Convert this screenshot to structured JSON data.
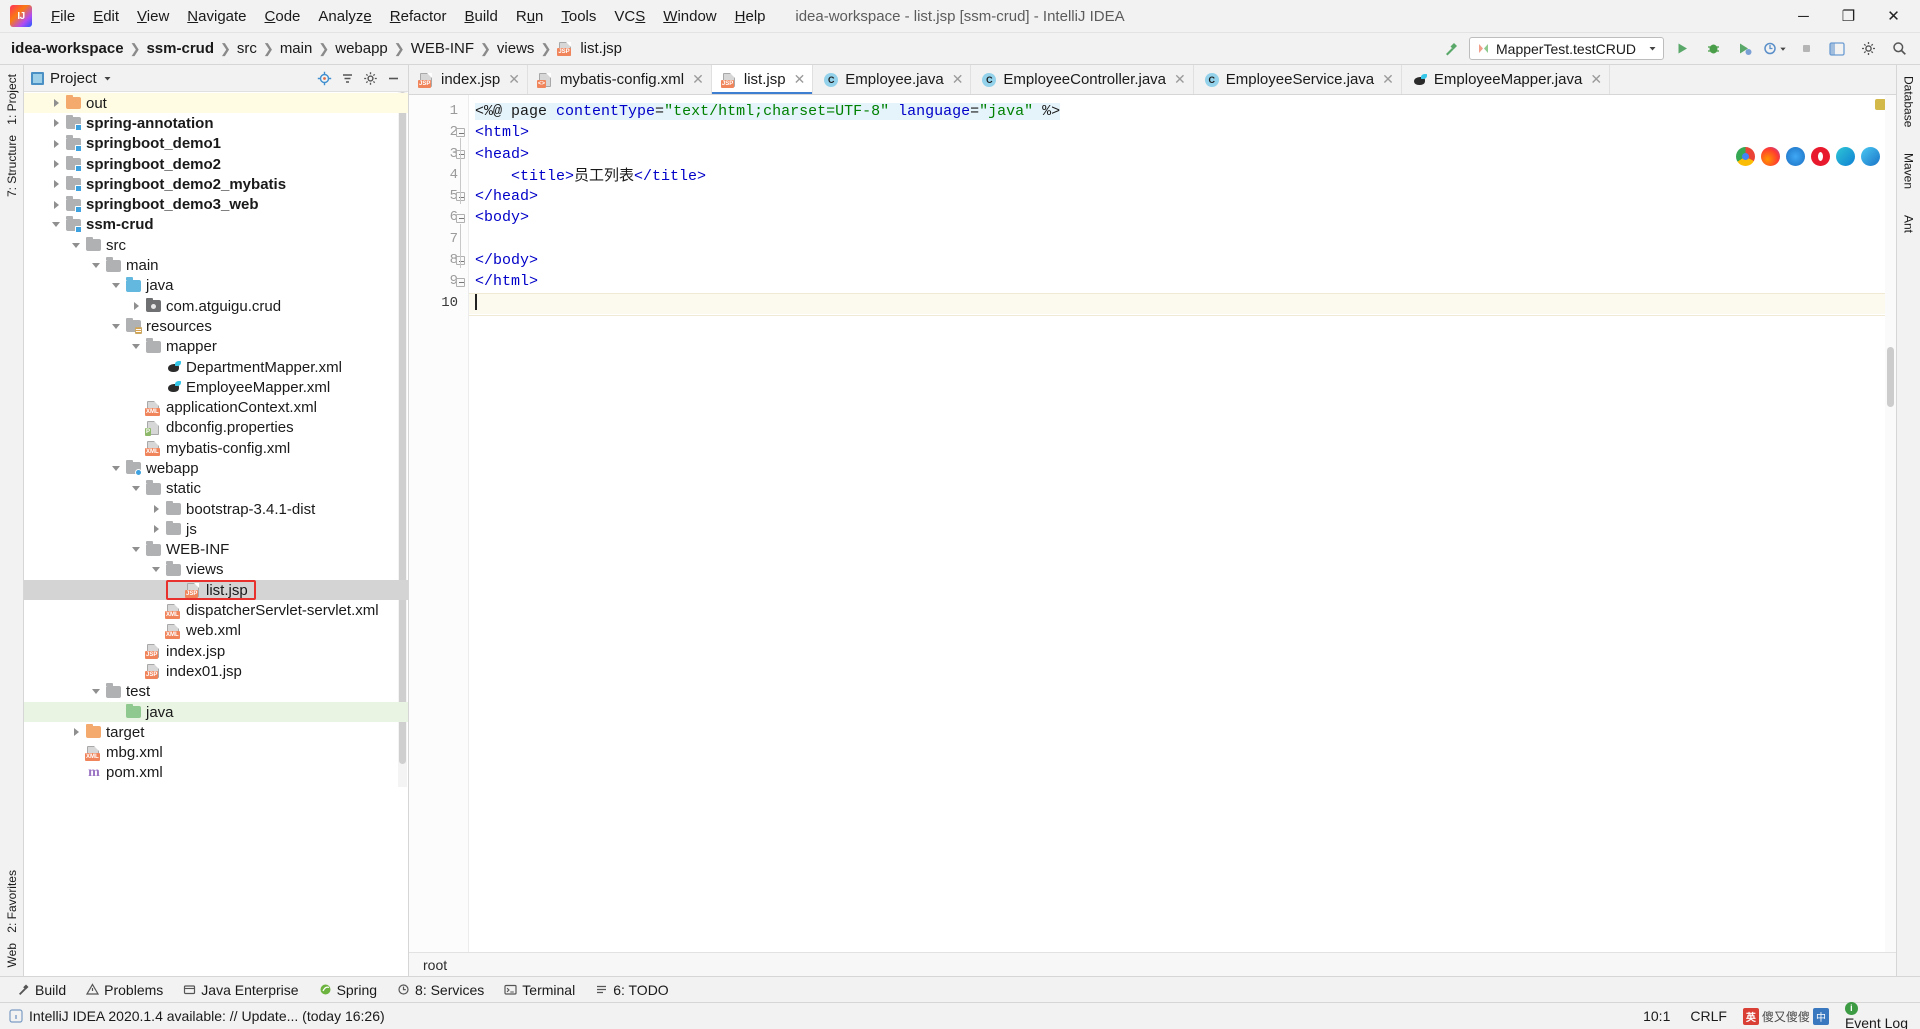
{
  "window": {
    "title": "idea-workspace - list.jsp [ssm-crud] - IntelliJ IDEA",
    "minimize": "─",
    "maximize": "❐",
    "close": "✕"
  },
  "menu": [
    {
      "label": "File"
    },
    {
      "label": "Edit"
    },
    {
      "label": "View"
    },
    {
      "label": "Navigate"
    },
    {
      "label": "Code"
    },
    {
      "label": "Analyze"
    },
    {
      "label": "Refactor"
    },
    {
      "label": "Build"
    },
    {
      "label": "Run"
    },
    {
      "label": "Tools"
    },
    {
      "label": "VCS"
    },
    {
      "label": "Window"
    },
    {
      "label": "Help"
    }
  ],
  "breadcrumb": [
    {
      "label": "idea-workspace",
      "bold": true
    },
    {
      "label": "ssm-crud",
      "bold": true
    },
    {
      "label": "src",
      "bold": false
    },
    {
      "label": "main",
      "bold": false
    },
    {
      "label": "webapp",
      "bold": false
    },
    {
      "label": "WEB-INF",
      "bold": false
    },
    {
      "label": "views",
      "bold": false
    },
    {
      "label": "list.jsp",
      "bold": false,
      "icon": "jsp-file-icon"
    }
  ],
  "toolbar": {
    "build_label": "build-hammer-icon",
    "run_config": "MapperTest.testCRUD",
    "run_icon": "run-icon",
    "debug_icon": "debug-icon",
    "run_coverage_icon": "run-with-coverage-icon",
    "profile_icon": "profiler-icon",
    "stop_icon": "stop-icon",
    "layout_icon": "layout-icon",
    "settings_icon": "settings-icon",
    "search_icon": "search-everywhere-icon"
  },
  "project_panel": {
    "title": "Project",
    "actions": [
      "locate-icon",
      "collapse-all-icon",
      "settings-icon",
      "hide-icon"
    ],
    "tree": [
      {
        "label": "out",
        "depth": 1,
        "arrow": "closed",
        "icon": "folder-orange",
        "bold": false,
        "hl": "yellow"
      },
      {
        "label": "spring-annotation",
        "depth": 1,
        "arrow": "closed",
        "icon": "module",
        "bold": true,
        "hl": ""
      },
      {
        "label": "springboot_demo1",
        "depth": 1,
        "arrow": "closed",
        "icon": "module",
        "bold": true,
        "hl": ""
      },
      {
        "label": "springboot_demo2",
        "depth": 1,
        "arrow": "closed",
        "icon": "module",
        "bold": true,
        "hl": ""
      },
      {
        "label": "springboot_demo2_mybatis",
        "depth": 1,
        "arrow": "closed",
        "icon": "module",
        "bold": true,
        "hl": ""
      },
      {
        "label": "springboot_demo3_web",
        "depth": 1,
        "arrow": "closed",
        "icon": "module",
        "bold": true,
        "hl": ""
      },
      {
        "label": "ssm-crud",
        "depth": 1,
        "arrow": "open",
        "icon": "module",
        "bold": true,
        "hl": ""
      },
      {
        "label": "src",
        "depth": 2,
        "arrow": "open",
        "icon": "folder-gray",
        "bold": false,
        "hl": ""
      },
      {
        "label": "main",
        "depth": 3,
        "arrow": "open",
        "icon": "folder-gray",
        "bold": false,
        "hl": ""
      },
      {
        "label": "java",
        "depth": 4,
        "arrow": "open",
        "icon": "folder-blue",
        "bold": false,
        "hl": ""
      },
      {
        "label": "com.atguigu.crud",
        "depth": 5,
        "arrow": "closed",
        "icon": "package",
        "bold": false,
        "hl": ""
      },
      {
        "label": "resources",
        "depth": 4,
        "arrow": "open",
        "icon": "folder-resources",
        "bold": false,
        "hl": ""
      },
      {
        "label": "mapper",
        "depth": 5,
        "arrow": "open",
        "icon": "folder-gray",
        "bold": false,
        "hl": ""
      },
      {
        "label": "DepartmentMapper.xml",
        "depth": 6,
        "arrow": "none",
        "icon": "mybatis",
        "bold": false,
        "hl": ""
      },
      {
        "label": "EmployeeMapper.xml",
        "depth": 6,
        "arrow": "none",
        "icon": "mybatis",
        "bold": false,
        "hl": ""
      },
      {
        "label": "applicationContext.xml",
        "depth": 5,
        "arrow": "none",
        "icon": "xml",
        "bold": false,
        "hl": ""
      },
      {
        "label": "dbconfig.properties",
        "depth": 5,
        "arrow": "none",
        "icon": "properties",
        "bold": false,
        "hl": ""
      },
      {
        "label": "mybatis-config.xml",
        "depth": 5,
        "arrow": "none",
        "icon": "xml",
        "bold": false,
        "hl": ""
      },
      {
        "label": "webapp",
        "depth": 4,
        "arrow": "open",
        "icon": "folder-webapp",
        "bold": false,
        "hl": ""
      },
      {
        "label": "static",
        "depth": 5,
        "arrow": "open",
        "icon": "folder-gray",
        "bold": false,
        "hl": ""
      },
      {
        "label": "bootstrap-3.4.1-dist",
        "depth": 6,
        "arrow": "closed",
        "icon": "folder-gray",
        "bold": false,
        "hl": ""
      },
      {
        "label": "js",
        "depth": 6,
        "arrow": "closed",
        "icon": "folder-gray",
        "bold": false,
        "hl": ""
      },
      {
        "label": "WEB-INF",
        "depth": 5,
        "arrow": "open",
        "icon": "folder-gray",
        "bold": false,
        "hl": ""
      },
      {
        "label": "views",
        "depth": 6,
        "arrow": "open",
        "icon": "folder-gray",
        "bold": false,
        "hl": ""
      },
      {
        "label": "list.jsp",
        "depth": 7,
        "arrow": "none",
        "icon": "jsp",
        "bold": false,
        "hl": "selected",
        "boxed": true
      },
      {
        "label": "dispatcherServlet-servlet.xml",
        "depth": 6,
        "arrow": "none",
        "icon": "xml",
        "bold": false,
        "hl": ""
      },
      {
        "label": "web.xml",
        "depth": 6,
        "arrow": "none",
        "icon": "xml",
        "bold": false,
        "hl": ""
      },
      {
        "label": "index.jsp",
        "depth": 5,
        "arrow": "none",
        "icon": "jsp",
        "bold": false,
        "hl": ""
      },
      {
        "label": "index01.jsp",
        "depth": 5,
        "arrow": "none",
        "icon": "jsp",
        "bold": false,
        "hl": ""
      },
      {
        "label": "test",
        "depth": 3,
        "arrow": "open",
        "icon": "folder-gray",
        "bold": false,
        "hl": ""
      },
      {
        "label": "java",
        "depth": 4,
        "arrow": "none",
        "icon": "folder-test",
        "bold": false,
        "hl": "green"
      },
      {
        "label": "target",
        "depth": 2,
        "arrow": "closed",
        "icon": "folder-orange",
        "bold": false,
        "hl": ""
      },
      {
        "label": "mbg.xml",
        "depth": 2,
        "arrow": "none",
        "icon": "xml",
        "bold": false,
        "hl": ""
      },
      {
        "label": "pom.xml",
        "depth": 2,
        "arrow": "none",
        "icon": "maven",
        "bold": false,
        "hl": ""
      }
    ]
  },
  "editor": {
    "tabs": [
      {
        "label": "index.jsp",
        "icon": "jsp",
        "active": false
      },
      {
        "label": "mybatis-config.xml",
        "icon": "xml-code",
        "active": false
      },
      {
        "label": "list.jsp",
        "icon": "jsp",
        "active": true
      },
      {
        "label": "Employee.java",
        "icon": "class",
        "active": false
      },
      {
        "label": "EmployeeController.java",
        "icon": "class",
        "active": false
      },
      {
        "label": "EmployeeService.java",
        "icon": "class",
        "active": false
      },
      {
        "label": "EmployeeMapper.java",
        "icon": "mybatis",
        "active": false
      }
    ],
    "line_numbers": [
      "1",
      "2",
      "3",
      "4",
      "5",
      "6",
      "7",
      "8",
      "9",
      "10"
    ],
    "code_lines": [
      {
        "n": 1,
        "tokens": [
          {
            "t": "<%@ page ",
            "c": "plain",
            "jsp": true
          },
          {
            "t": "contentType",
            "c": "attr",
            "jsp": true
          },
          {
            "t": "=",
            "c": "plain",
            "jsp": true
          },
          {
            "t": "\"text/html;charset=UTF-8\"",
            "c": "str",
            "jsp": true
          },
          {
            "t": " ",
            "c": "plain",
            "jsp": true
          },
          {
            "t": "language",
            "c": "attr",
            "jsp": true
          },
          {
            "t": "=",
            "c": "plain",
            "jsp": true
          },
          {
            "t": "\"java\"",
            "c": "str",
            "jsp": true
          },
          {
            "t": " %>",
            "c": "plain",
            "jsp": true
          }
        ]
      },
      {
        "n": 2,
        "tokens": [
          {
            "t": "<html>",
            "c": "tag"
          }
        ]
      },
      {
        "n": 3,
        "tokens": [
          {
            "t": "<head>",
            "c": "tag"
          }
        ]
      },
      {
        "n": 4,
        "tokens": [
          {
            "t": "    <title>",
            "c": "tag"
          },
          {
            "t": "员工列表",
            "c": "cjk"
          },
          {
            "t": "</title>",
            "c": "tag"
          }
        ]
      },
      {
        "n": 5,
        "tokens": [
          {
            "t": "</head>",
            "c": "tag"
          }
        ]
      },
      {
        "n": 6,
        "tokens": [
          {
            "t": "<body>",
            "c": "tag"
          }
        ]
      },
      {
        "n": 7,
        "tokens": []
      },
      {
        "n": 8,
        "tokens": [
          {
            "t": "</body>",
            "c": "tag"
          }
        ]
      },
      {
        "n": 9,
        "tokens": [
          {
            "t": "</html>",
            "c": "tag"
          }
        ]
      },
      {
        "n": 10,
        "tokens": [],
        "caret": true
      }
    ],
    "browsers": [
      "chrome-icon",
      "firefox-icon",
      "ie-icon",
      "opera-icon",
      "edge-legacy-icon",
      "edge-icon"
    ],
    "footer_breadcrumb": "root"
  },
  "left_strips": {
    "top": [
      "1: Project",
      "7: Structure"
    ],
    "bottom": [
      "2: Favorites",
      "Web"
    ]
  },
  "right_strips": [
    "Database",
    "Maven",
    "Ant"
  ],
  "bottom_tools": [
    {
      "label": "Build",
      "icon": "hammer-icon"
    },
    {
      "label": "Problems",
      "icon": "warning-icon"
    },
    {
      "label": "Java Enterprise",
      "icon": "enterprise-icon"
    },
    {
      "label": "Spring",
      "icon": "spring-icon"
    },
    {
      "label": "8: Services",
      "icon": "services-icon"
    },
    {
      "label": "Terminal",
      "icon": "terminal-icon"
    },
    {
      "label": "6: TODO",
      "icon": "todo-icon"
    }
  ],
  "status": {
    "message": "IntelliJ IDEA 2020.1.4 available: // Update... (today 16:26)",
    "message_icon": "info-icon",
    "caret_position": "10:1",
    "line_separator": "CRLF",
    "event_log": "Event Log",
    "event_log_icon": "event-log-icon",
    "watermark": {
      "tag": "英",
      "text": "傻又傻傻",
      "box": "中"
    }
  }
}
